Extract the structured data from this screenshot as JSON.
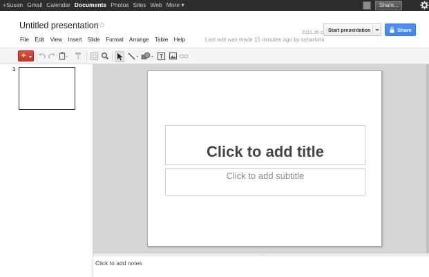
{
  "gbar": {
    "items": [
      "+Susan",
      "Gmail",
      "Calendar",
      "Documents",
      "Photos",
      "Sites",
      "Web",
      "More ▾"
    ],
    "active_index": 3,
    "share_label": "Share..."
  },
  "header": {
    "title": "Untitled presentation",
    "version": "2011.36-c",
    "start_presentation_label": "Start presentation",
    "share_label": "Share"
  },
  "menu": {
    "items": [
      "File",
      "Edit",
      "View",
      "Insert",
      "Slide",
      "Format",
      "Arrange",
      "Table",
      "Help"
    ],
    "last_edit": "Last edit was made 15 minutes ago by ssharkins"
  },
  "toolbar": {
    "icons": [
      "new-slide-icon",
      "undo-icon",
      "redo-icon",
      "paint-format-icon",
      "zoom-fit-icon",
      "zoom-icon",
      "select-icon",
      "line-icon",
      "shape-icon",
      "text-box-icon",
      "image-icon",
      "link-icon"
    ]
  },
  "slides": {
    "thumb_number": "1"
  },
  "slide": {
    "title_placeholder": "Click to add title",
    "subtitle_placeholder": "Click to add subtitle"
  },
  "notes": {
    "placeholder": "Click to add notes"
  },
  "colors": {
    "gbar_bg": "#2d2d2d",
    "share_blue": "#4d90fe",
    "new_red": "#d14836",
    "canvas_bg": "#d5d5d5"
  }
}
